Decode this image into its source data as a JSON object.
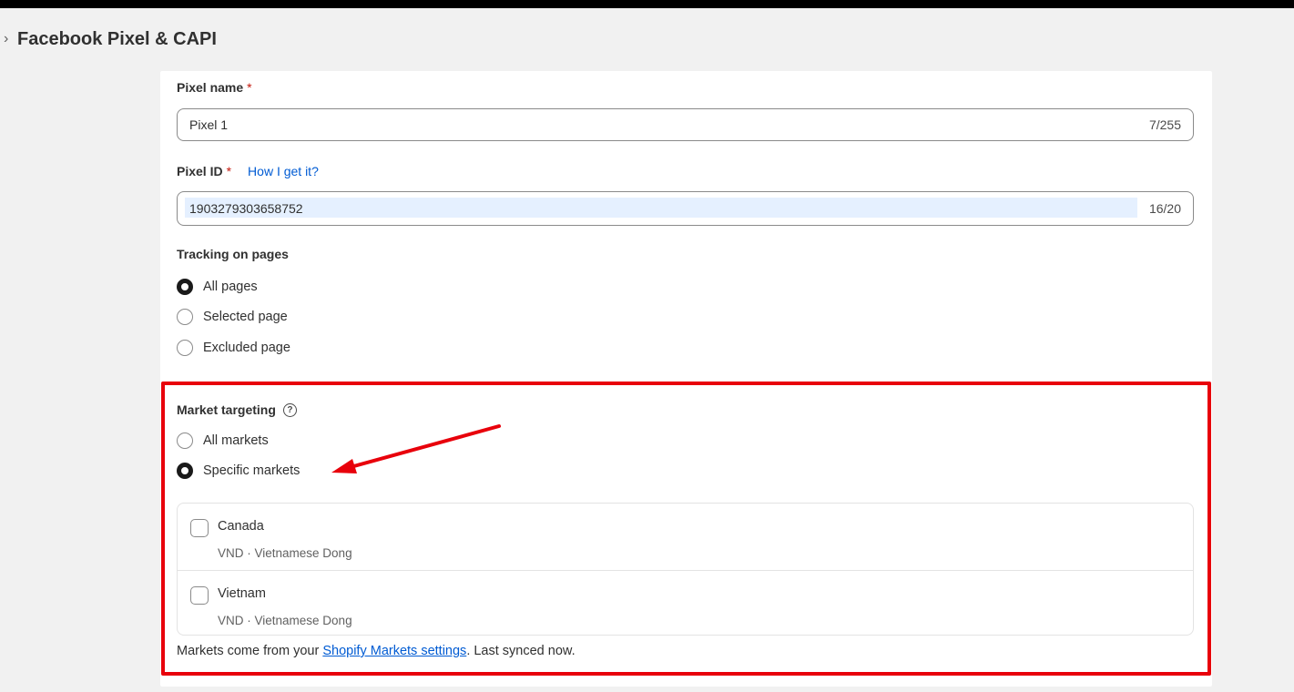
{
  "header": {
    "chevron": "›",
    "title": "Facebook Pixel & CAPI"
  },
  "form": {
    "pixel_name": {
      "label": "Pixel name",
      "required": "*",
      "value": "Pixel 1",
      "count": "7/255"
    },
    "pixel_id": {
      "label": "Pixel ID",
      "required": "*",
      "help_link": "How I get it?",
      "value": "1903279303658752",
      "count": "16/20"
    },
    "tracking": {
      "label": "Tracking on pages",
      "options": [
        {
          "label": "All pages",
          "checked": true
        },
        {
          "label": "Selected page",
          "checked": false
        },
        {
          "label": "Excluded page",
          "checked": false
        }
      ]
    },
    "market_targeting": {
      "label": "Market targeting",
      "help_icon": "?",
      "options": [
        {
          "label": "All markets",
          "checked": false
        },
        {
          "label": "Specific markets",
          "checked": true
        }
      ],
      "markets": [
        {
          "name": "Canada",
          "currency": "VND · Vietnamese Dong",
          "checked": false
        },
        {
          "name": "Vietnam",
          "currency": "VND · Vietnamese Dong",
          "checked": false
        }
      ],
      "footer": {
        "prefix": "Markets come from your ",
        "link": "Shopify Markets settings",
        "suffix": ". Last synced now."
      }
    }
  },
  "colors": {
    "accent_link": "#005bd3",
    "highlight": "#e8000b",
    "required": "#c4170c"
  }
}
